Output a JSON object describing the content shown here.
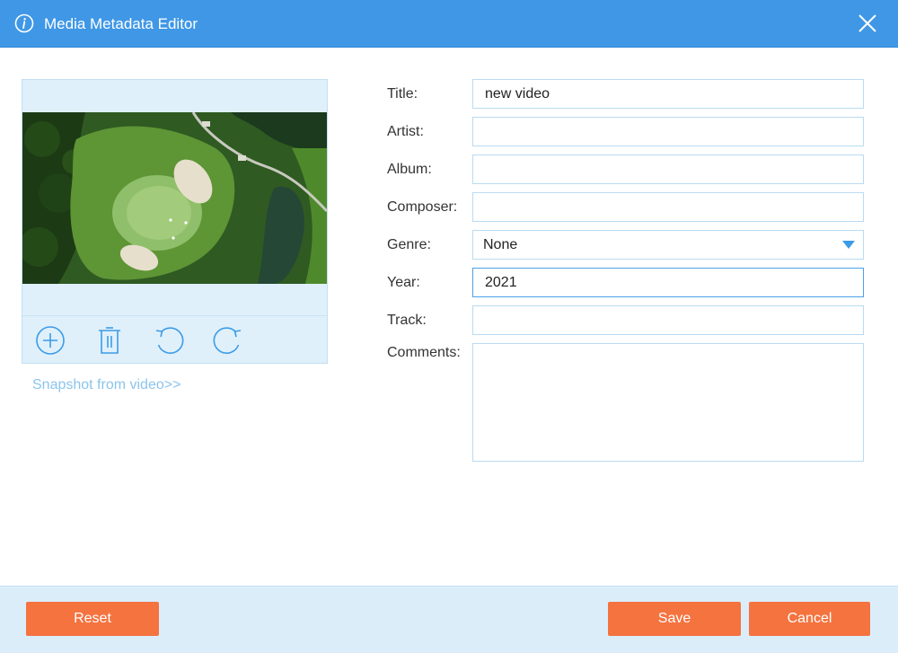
{
  "window": {
    "title": "Media Metadata Editor",
    "info_icon": "info-icon",
    "close_icon": "close-icon"
  },
  "cover": {
    "tools": [
      {
        "name": "add-icon"
      },
      {
        "name": "delete-icon"
      },
      {
        "name": "rotate-left-icon"
      },
      {
        "name": "rotate-right-icon"
      }
    ],
    "snapshot_link": "Snapshot from video>>"
  },
  "form": {
    "title_label": "Title:",
    "title_value": "new video",
    "artist_label": "Artist:",
    "artist_value": "",
    "album_label": "Album:",
    "album_value": "",
    "composer_label": "Composer:",
    "composer_value": "",
    "genre_label": "Genre:",
    "genre_value": "None",
    "year_label": "Year:",
    "year_value": "2021",
    "track_label": "Track:",
    "track_value": "",
    "comments_label": "Comments:",
    "comments_value": ""
  },
  "footer": {
    "reset_label": "Reset",
    "save_label": "Save",
    "cancel_label": "Cancel"
  },
  "colors": {
    "titlebar": "#3f97e6",
    "accent_button": "#f4733f",
    "panel": "#dff0fb",
    "icon": "#3d9be6",
    "link": "#8cc4ec"
  }
}
